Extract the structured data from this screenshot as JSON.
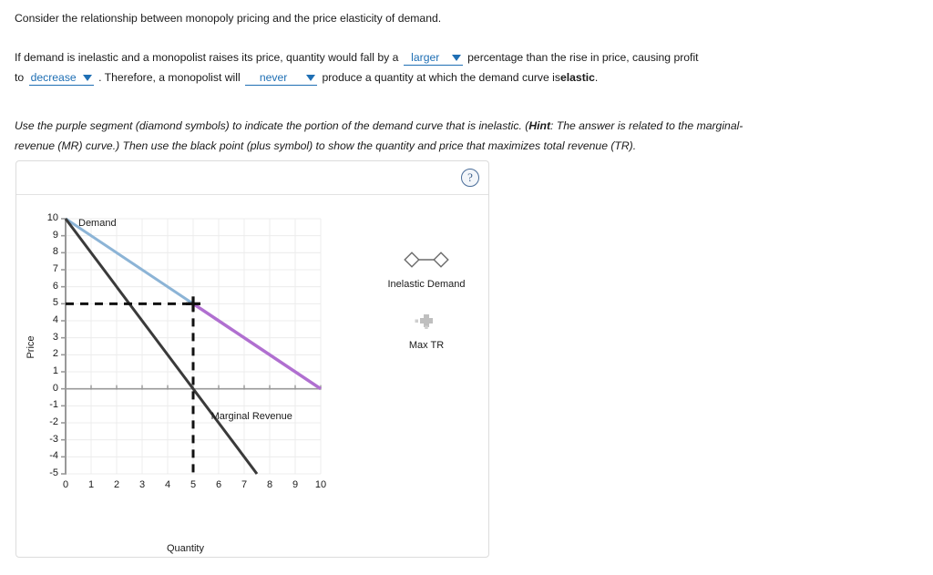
{
  "question": {
    "intro": "Consider the relationship between monopoly pricing and the price elasticity of demand.",
    "sentence_1_part_1": "If demand is inelastic and a monopolist raises its price, quantity would fall by a",
    "sentence_1_part_2": "percentage than the rise in price, causing profit",
    "sentence_2_part_1": "to",
    "sentence_2_part_2": ". Therefore, a monopolist will",
    "sentence_2_part_3": "produce a quantity at which the demand curve is",
    "sentence_2_bold": "elastic",
    "sentence_2_end": ".",
    "dropdowns": {
      "elasticity_magnitude": "larger",
      "profit_direction": "decrease",
      "frequency": "never"
    }
  },
  "instructions": {
    "line_1_a": "Use the purple segment (diamond symbols) to indicate the portion of the demand curve that is inelastic. (",
    "line_1_hint_bold": "Hint",
    "line_1_b": ": The answer is related to the marginal-",
    "line_2": "revenue (MR) curve.) Then use the black point (plus symbol) to show the quantity and price that maximizes total revenue (TR)."
  },
  "panel": {
    "help_icon": "question-mark-icon",
    "help_label": "?"
  },
  "legend": {
    "entries": [
      {
        "symbol": "diamond-line-diamond-icon",
        "caption": "Inelastic Demand",
        "color": "#6b6b6b"
      },
      {
        "symbol": "plus-icon",
        "caption": "Max TR",
        "color": "#bfbfbf"
      }
    ]
  },
  "chart_data": {
    "type": "line",
    "title": "",
    "xlabel": "Quantity",
    "ylabel": "Price",
    "xlim": [
      0,
      10
    ],
    "ylim": [
      -5,
      10
    ],
    "xticks": [
      0,
      1,
      2,
      3,
      4,
      5,
      6,
      7,
      8,
      9,
      10
    ],
    "yticks": [
      -5,
      -4,
      -3,
      -2,
      -1,
      0,
      1,
      2,
      3,
      4,
      5,
      6,
      7,
      8,
      9,
      10
    ],
    "grid": true,
    "legend_position": "right",
    "series": [
      {
        "name": "Demand",
        "label": "Demand",
        "color": "#8cb4d6",
        "style": "solid",
        "width": 3,
        "points": [
          {
            "x": 0,
            "y": 10
          },
          {
            "x": 5,
            "y": 5
          }
        ]
      },
      {
        "name": "Inelastic Demand",
        "label": "",
        "color": "#b06fd0",
        "style": "solid",
        "width": 3.5,
        "points": [
          {
            "x": 5,
            "y": 5
          },
          {
            "x": 10,
            "y": 0
          }
        ]
      },
      {
        "name": "Marginal Revenue",
        "label": "Marginal Revenue",
        "color": "#3a3a3a",
        "style": "solid",
        "width": 3,
        "points": [
          {
            "x": 0,
            "y": 10
          },
          {
            "x": 7.5,
            "y": -5
          }
        ]
      },
      {
        "name": "Max TR guide - horizontal",
        "label": "",
        "color": "#111111",
        "style": "dashed",
        "width": 3,
        "points": [
          {
            "x": 0,
            "y": 5
          },
          {
            "x": 5,
            "y": 5
          }
        ]
      },
      {
        "name": "Max TR guide - vertical",
        "label": "",
        "color": "#111111",
        "style": "dashed",
        "width": 3,
        "points": [
          {
            "x": 5,
            "y": 5
          },
          {
            "x": 5,
            "y": -5
          }
        ]
      }
    ],
    "markers": [
      {
        "name": "Max TR",
        "symbol": "plus",
        "x": 5,
        "y": 5,
        "color": "#111111"
      }
    ],
    "annotations": [
      {
        "text": "Demand",
        "x": 0.5,
        "y": 9.7
      },
      {
        "text": "Marginal Revenue",
        "x": 5.7,
        "y": -1.7
      }
    ]
  }
}
